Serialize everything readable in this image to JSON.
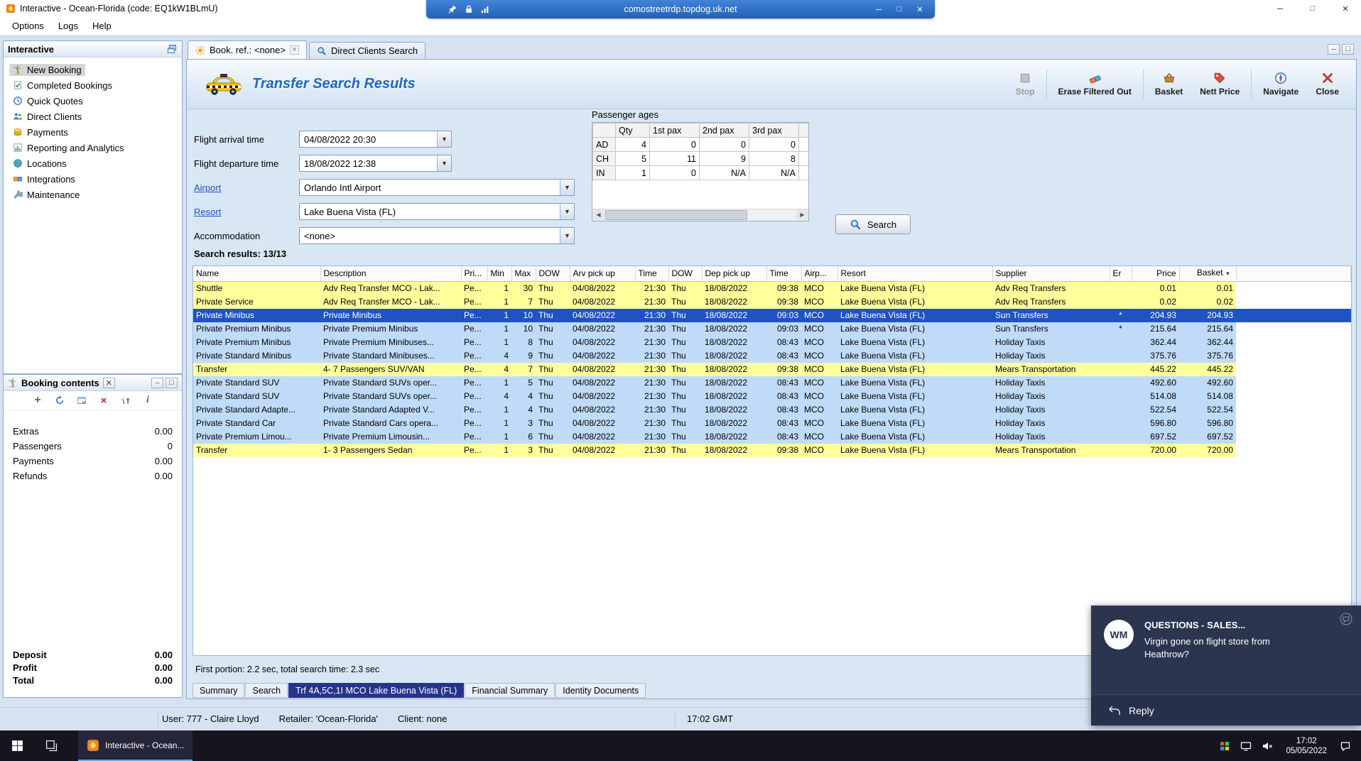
{
  "window": {
    "title": "Interactive - Ocean-Florida (code: EQ1kW1BLmU)",
    "rdp_host": "comostreetrdp.topdog.uk.net"
  },
  "menubar": [
    "Options",
    "Logs",
    "Help"
  ],
  "sidebar": {
    "title": "Interactive",
    "items": [
      {
        "label": "New Booking",
        "icon": "palm-tree-icon",
        "selected": true
      },
      {
        "label": "Completed Bookings",
        "icon": "completed-bookings-icon"
      },
      {
        "label": "Quick Quotes",
        "icon": "quick-quotes-icon"
      },
      {
        "label": "Direct Clients",
        "icon": "direct-clients-icon"
      },
      {
        "label": "Payments",
        "icon": "payments-icon"
      },
      {
        "label": "Reporting and Analytics",
        "icon": "reporting-icon"
      },
      {
        "label": "Locations",
        "icon": "locations-icon"
      },
      {
        "label": "Integrations",
        "icon": "integrations-icon"
      },
      {
        "label": "Maintenance",
        "icon": "maintenance-icon"
      }
    ]
  },
  "booking_contents": {
    "title": "Booking contents",
    "toolbar_icons": [
      "add-icon",
      "refresh-icon",
      "window-icon",
      "delete-icon",
      "export-icon",
      "info-icon"
    ],
    "rows": [
      {
        "label": "Extras",
        "value": "0.00"
      },
      {
        "label": "Passengers",
        "value": "0"
      },
      {
        "label": "Payments",
        "value": "0.00"
      },
      {
        "label": "Refunds",
        "value": "0.00"
      }
    ],
    "totals": [
      {
        "label": "Deposit",
        "value": "0.00"
      },
      {
        "label": "Profit",
        "value": "0.00"
      },
      {
        "label": "Total",
        "value": "0.00"
      }
    ]
  },
  "tabs": [
    {
      "label": "Book. ref.: <none>",
      "icon": "sun-icon",
      "active": true,
      "closable": true
    },
    {
      "label": "Direct Clients Search",
      "icon": "search-icon",
      "active": false,
      "closable": false
    }
  ],
  "transfer_search": {
    "title": "Transfer Search Results",
    "toolbar": [
      {
        "label": "Stop",
        "icon": "stop-icon",
        "disabled": true
      },
      {
        "label": "Erase Filtered Out",
        "icon": "eraser-icon"
      },
      {
        "label": "Basket",
        "icon": "basket-icon"
      },
      {
        "label": "Nett Price",
        "icon": "price-tag-icon"
      },
      {
        "label": "Navigate",
        "icon": "compass-icon"
      },
      {
        "label": "Close",
        "icon": "close-x-icon"
      }
    ],
    "form": [
      {
        "label": "Flight arrival time",
        "value": "04/08/2022 20:30",
        "kind": "date"
      },
      {
        "label": "Flight departure time",
        "value": "18/08/2022 12:38",
        "kind": "date"
      },
      {
        "label": "Airport",
        "value": "Orlando Intl Airport",
        "kind": "combo",
        "link": true
      },
      {
        "label": "Resort",
        "value": "Lake Buena Vista (FL)",
        "kind": "combo",
        "link": true
      },
      {
        "label": "Accommodation",
        "value": "<none>",
        "kind": "combo"
      }
    ],
    "passenger_ages": {
      "title": "Passenger ages",
      "columns": [
        "",
        "Qty",
        "1st pax",
        "2nd pax",
        "3rd pax"
      ],
      "rows": [
        [
          "AD",
          "4",
          "0",
          "0",
          "0"
        ],
        [
          "CH",
          "5",
          "11",
          "9",
          "8"
        ],
        [
          "IN",
          "1",
          "0",
          "N/A",
          "N/A"
        ]
      ]
    },
    "search_button": "Search",
    "results_label": "Search results: 13/13",
    "results_columns": [
      "Name",
      "Description",
      "Pri...",
      "Min",
      "Max",
      "DOW",
      "Arv pick up",
      "Time",
      "DOW",
      "Dep pick up",
      "Time",
      "Airp...",
      "Resort",
      "Supplier",
      "Er",
      "Price",
      "Basket"
    ],
    "results_rows": [
      {
        "cells": [
          "Shuttle",
          "Adv Req Transfer MCO - Lak...",
          "Pe...",
          "1",
          "30",
          "Thu",
          "04/08/2022",
          "21:30",
          "Thu",
          "18/08/2022",
          "09:38",
          "MCO",
          "Lake Buena Vista (FL)",
          "Adv Req Transfers",
          "",
          "0.01",
          "0.01"
        ],
        "highlight": "yellow"
      },
      {
        "cells": [
          "Private Service",
          "Adv Req Transfer MCO - Lak...",
          "Pe...",
          "1",
          "7",
          "Thu",
          "04/08/2022",
          "21:30",
          "Thu",
          "18/08/2022",
          "09:38",
          "MCO",
          "Lake Buena Vista (FL)",
          "Adv Req Transfers",
          "",
          "0.02",
          "0.02"
        ],
        "highlight": "yellow"
      },
      {
        "cells": [
          "Private Minibus",
          "Private Minibus",
          "Pe...",
          "1",
          "10",
          "Thu",
          "04/08/2022",
          "21:30",
          "Thu",
          "18/08/2022",
          "09:03",
          "MCO",
          "Lake Buena Vista (FL)",
          "Sun Transfers",
          "*",
          "204.93",
          "204.93"
        ],
        "highlight": "selected"
      },
      {
        "cells": [
          "Private Premium Minibus",
          "Private Premium Minibus",
          "Pe...",
          "1",
          "10",
          "Thu",
          "04/08/2022",
          "21:30",
          "Thu",
          "18/08/2022",
          "09:03",
          "MCO",
          "Lake Buena Vista (FL)",
          "Sun Transfers",
          "*",
          "215.64",
          "215.64"
        ],
        "highlight": "blue"
      },
      {
        "cells": [
          "Private Premium Minibus",
          "Private Premium Minibuses...",
          "Pe...",
          "1",
          "8",
          "Thu",
          "04/08/2022",
          "21:30",
          "Thu",
          "18/08/2022",
          "08:43",
          "MCO",
          "Lake Buena Vista (FL)",
          "Holiday Taxis",
          "",
          "362.44",
          "362.44"
        ],
        "highlight": "blue"
      },
      {
        "cells": [
          "Private Standard Minibus",
          "Private Standard Minibuses...",
          "Pe...",
          "4",
          "9",
          "Thu",
          "04/08/2022",
          "21:30",
          "Thu",
          "18/08/2022",
          "08:43",
          "MCO",
          "Lake Buena Vista (FL)",
          "Holiday Taxis",
          "",
          "375.76",
          "375.76"
        ],
        "highlight": "blue"
      },
      {
        "cells": [
          "Transfer",
          "4- 7 Passengers SUV/VAN",
          "Pe...",
          "4",
          "7",
          "Thu",
          "04/08/2022",
          "21:30",
          "Thu",
          "18/08/2022",
          "09:38",
          "MCO",
          "Lake Buena Vista (FL)",
          "Mears Transportation",
          "",
          "445.22",
          "445.22"
        ],
        "highlight": "yellow"
      },
      {
        "cells": [
          "Private Standard SUV",
          "Private Standard SUVs oper...",
          "Pe...",
          "1",
          "5",
          "Thu",
          "04/08/2022",
          "21:30",
          "Thu",
          "18/08/2022",
          "08:43",
          "MCO",
          "Lake Buena Vista (FL)",
          "Holiday Taxis",
          "",
          "492.60",
          "492.60"
        ],
        "highlight": "blue"
      },
      {
        "cells": [
          "Private Standard SUV",
          "Private Standard SUVs oper...",
          "Pe...",
          "4",
          "4",
          "Thu",
          "04/08/2022",
          "21:30",
          "Thu",
          "18/08/2022",
          "08:43",
          "MCO",
          "Lake Buena Vista (FL)",
          "Holiday Taxis",
          "",
          "514.08",
          "514.08"
        ],
        "highlight": "blue"
      },
      {
        "cells": [
          "Private Standard Adapte...",
          "Private Standard Adapted V...",
          "Pe...",
          "1",
          "4",
          "Thu",
          "04/08/2022",
          "21:30",
          "Thu",
          "18/08/2022",
          "08:43",
          "MCO",
          "Lake Buena Vista (FL)",
          "Holiday Taxis",
          "",
          "522.54",
          "522.54"
        ],
        "highlight": "blue"
      },
      {
        "cells": [
          "Private Standard Car",
          "Private Standard Cars opera...",
          "Pe...",
          "1",
          "3",
          "Thu",
          "04/08/2022",
          "21:30",
          "Thu",
          "18/08/2022",
          "08:43",
          "MCO",
          "Lake Buena Vista (FL)",
          "Holiday Taxis",
          "",
          "596.80",
          "596.80"
        ],
        "highlight": "blue"
      },
      {
        "cells": [
          "Private Premium Limou...",
          "Private Premium Limousin...",
          "Pe...",
          "1",
          "6",
          "Thu",
          "04/08/2022",
          "21:30",
          "Thu",
          "18/08/2022",
          "08:43",
          "MCO",
          "Lake Buena Vista (FL)",
          "Holiday Taxis",
          "",
          "697.52",
          "697.52"
        ],
        "highlight": "blue"
      },
      {
        "cells": [
          "Transfer",
          "1- 3 Passengers Sedan",
          "Pe...",
          "1",
          "3",
          "Thu",
          "04/08/2022",
          "21:30",
          "Thu",
          "18/08/2022",
          "09:38",
          "MCO",
          "Lake Buena Vista (FL)",
          "Mears Transportation",
          "",
          "720.00",
          "720.00"
        ],
        "highlight": "yellow"
      }
    ],
    "status_line": "First portion: 2.2 sec, total search time: 2.3 sec",
    "bottom_tabs": [
      {
        "label": "Summary"
      },
      {
        "label": "Search"
      },
      {
        "label": "Trf 4A,5C,1I MCO Lake Buena Vista (FL)",
        "active": true
      },
      {
        "label": "Financial Summary"
      },
      {
        "label": "Identity Documents"
      }
    ]
  },
  "statusbar": {
    "user": "User: 777 - Claire Lloyd",
    "retailer": "Retailer: 'Ocean-Florida'",
    "client": "Client: none",
    "time": "17:02 GMT"
  },
  "notification": {
    "avatar": "WM",
    "title": "QUESTIONS - SALES...",
    "body": "Virgin gone on flight store from Heathrow?",
    "reply_label": "Reply"
  },
  "taskbar": {
    "app_label": "Interactive - Ocean...",
    "time": "17:02",
    "date": "05/05/2022"
  },
  "colors": {
    "accent_blue": "#1a68c4",
    "row_yellow": "#ffff9c",
    "row_blue": "#bfdbf7",
    "row_selected": "#2152c4",
    "bottom_tab_active": "#27348b"
  }
}
